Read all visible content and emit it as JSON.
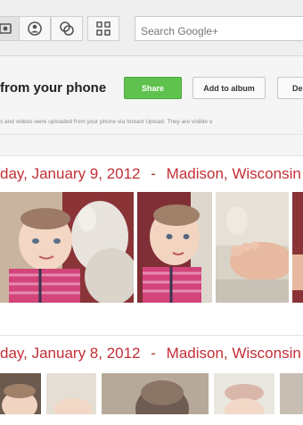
{
  "nav": {
    "buttons": [
      {
        "name": "photos-icon"
      },
      {
        "name": "profile-icon"
      },
      {
        "name": "circles-icon"
      },
      {
        "name": "apps-grid-icon"
      }
    ],
    "search_placeholder": "Search Google+"
  },
  "header": {
    "title": "from your phone",
    "share_label": "Share",
    "add_to_album_label": "Add to album",
    "more_label": "De",
    "info_text": "s and videos were uploaded from your phone via Instant Upload. They are visible o"
  },
  "groups": [
    {
      "date": "day, January 9, 2012",
      "separator": "-",
      "location": "Madison, Wisconsin"
    },
    {
      "date": "day, January 8, 2012",
      "separator": "-",
      "location": "Madison, Wisconsin"
    }
  ],
  "colors": {
    "accent_red": "#c22f36",
    "share_green": "#5fc24f",
    "stripe_pink": "#d2447a"
  }
}
